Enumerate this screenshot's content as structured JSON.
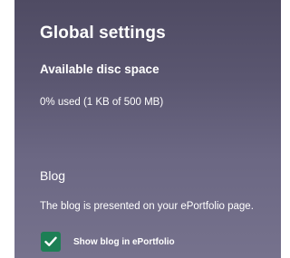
{
  "settings": {
    "title": "Global settings",
    "disc_space": {
      "heading": "Available disc space",
      "usage_text": "0% used (1 KB of 500 MB)",
      "used_percent": 0
    },
    "blog": {
      "heading": "Blog",
      "description": "The blog is presented on your ePortfolio page.",
      "show_blog_checkbox": {
        "label": "Show blog in ePortfolio",
        "checked": true,
        "icon": "checkmark-icon"
      }
    }
  },
  "colors": {
    "panel_top": "#4f4b63",
    "panel_bottom": "#76728d",
    "checkbox_fill": "#1d7f55",
    "text": "#ffffff"
  }
}
